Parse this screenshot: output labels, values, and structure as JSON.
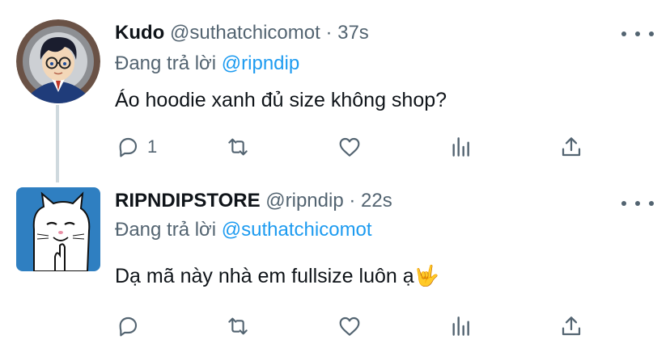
{
  "tweets": [
    {
      "name": "Kudo",
      "handle": "@suthatchicomot",
      "sep": "·",
      "time": "37s",
      "replying_prefix": "Đang trả lời",
      "replying_to": "@ripndip",
      "text": "Áo hoodie xanh đủ size không shop?",
      "reply_count": "1"
    },
    {
      "name": "RIPNDIPSTORE",
      "handle": "@ripndip",
      "sep": "·",
      "time": "22s",
      "replying_prefix": "Đang trả lời",
      "replying_to": "@suthatchicomot",
      "text": "Dạ mã này nhà em fullsize luôn ạ",
      "emoji": "🤟",
      "reply_count": ""
    }
  ],
  "colors": {
    "muted": "#536471",
    "link": "#1d9bf0",
    "text": "#0f1419",
    "thread_line": "#cfd9de",
    "ripndip_avatar_bg": "#2f7fc1"
  },
  "icons": [
    "reply-icon",
    "retweet-icon",
    "like-icon",
    "analytics-icon",
    "share-icon",
    "more-icon"
  ]
}
